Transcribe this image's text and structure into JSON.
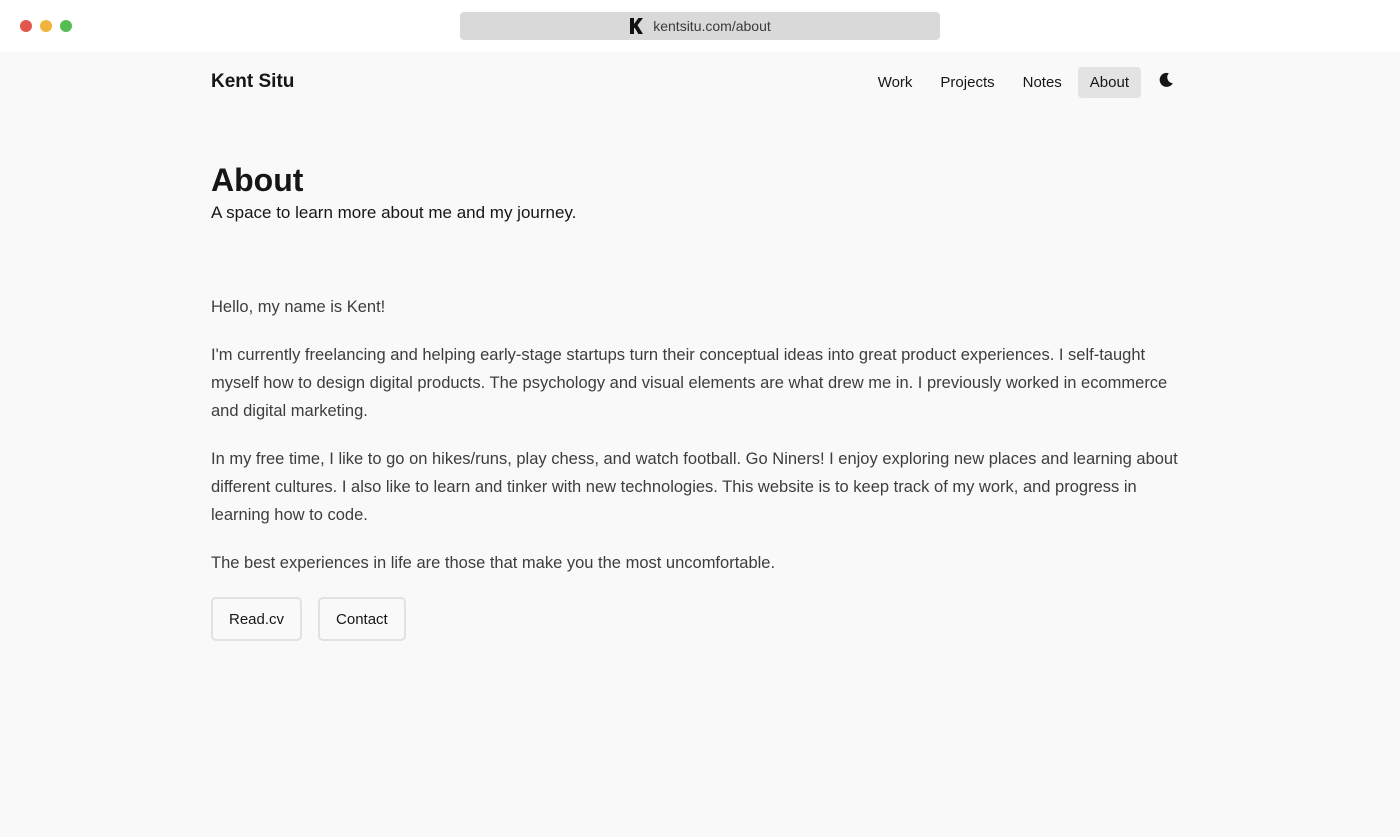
{
  "browser": {
    "url": "kentsitu.com/about",
    "favicon": "k-logo-icon"
  },
  "header": {
    "site_name": "Kent Situ",
    "nav": [
      {
        "label": "Work",
        "active": false
      },
      {
        "label": "Projects",
        "active": false
      },
      {
        "label": "Notes",
        "active": false
      },
      {
        "label": "About",
        "active": true
      }
    ],
    "theme_toggle_icon": "moon-icon"
  },
  "main": {
    "title": "About",
    "subtitle": "A space to learn more about me and my journey.",
    "paragraphs": [
      "Hello, my name is Kent!",
      "I'm currently freelancing and helping early-stage startups turn their conceptual ideas into great product experiences. I self-taught myself how to design digital products. The psychology and visual elements are what drew me in. I previously worked in ecommerce and digital marketing.",
      "In my free time, I like to go on hikes/runs, play chess, and watch football. Go Niners! I enjoy exploring new places and learning about different cultures. I also like to learn and tinker with new technologies. This website is to keep track of my work, and progress in learning how to code.",
      "The best experiences in life are those that make you the most uncomfortable."
    ],
    "buttons": {
      "readcv_label": "Read.cv",
      "contact_label": "Contact"
    }
  },
  "colors": {
    "page_background": "#f9f9f9",
    "text_primary": "#161616",
    "text_body": "#3d3d3d",
    "nav_active_background": "#e3e3e3",
    "button_border": "#e1e1e1"
  }
}
